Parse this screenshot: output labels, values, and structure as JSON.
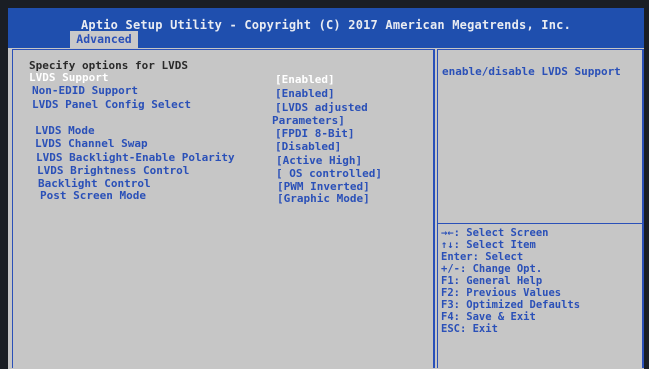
{
  "header": {
    "title": "Aptio Setup Utility - Copyright (C) 2017 American Megatrends, Inc.",
    "active_tab": "Advanced"
  },
  "main": {
    "section_title": "Specify options for LVDS",
    "settings": [
      {
        "label": "LVDS Support",
        "value": "[Enabled]",
        "selected": true
      },
      {
        "label": "Non-EDID Support",
        "value": "[Enabled]",
        "selected": false
      },
      {
        "label": "LVDS Panel Config Select",
        "value": "[LVDS adjusted",
        "value_cont": "Parameters]",
        "selected": false
      },
      {
        "label": "LVDS Mode",
        "value": "[FPDI 8-Bit]",
        "selected": false
      },
      {
        "label": "LVDS Channel Swap",
        "value": "[Disabled]",
        "selected": false
      },
      {
        "label": "LVDS Backlight-Enable Polarity",
        "value": "[Active High]",
        "selected": false
      },
      {
        "label": "LVDS Brightness Control",
        "value": "[ OS controlled]",
        "selected": false
      },
      {
        "label": "Backlight Control",
        "value": "[PWM Inverted]",
        "selected": false
      },
      {
        "label": "Post Screen Mode",
        "value": "[Graphic Mode]",
        "selected": false
      }
    ]
  },
  "help": {
    "text": "enable/disable LVDS Support"
  },
  "keys": [
    "→←: Select Screen",
    "↑↓: Select Item",
    "Enter: Select",
    "+/-: Change Opt.",
    "F1: General Help",
    "F2: Previous Values",
    "F3: Optimized Defaults",
    "F4: Save & Exit",
    "ESC: Exit"
  ],
  "colors": {
    "header_bg": "#1f4fae",
    "panel_bg": "#c6c6c6",
    "accent_text": "#2a50b8",
    "selected_text": "#ffffff"
  }
}
